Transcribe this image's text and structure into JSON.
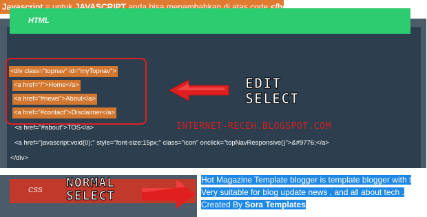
{
  "top_note": {
    "prefix": "Javascript",
    "middle": " = untuk ",
    "lang": "JAVASCRIPT",
    "suffix": " anda bisa menambahkan di atas code ",
    "tag": "</body>"
  },
  "html_panel": {
    "title": "HTML",
    "code_lines": [
      "<div class=\"topnav\" id=\"myTopnav\">",
      "<a href=\"/\">Home</a>",
      "<a href=\"#news\">About</a>",
      "<a href=\"#contact\">Disclaimer</a>",
      "<a href=\"#about\">TOS</a>",
      "<a href=\"javascript:void(0);\" style=\"font-size:15px;\" class=\"icon\" onclick=\"topNavResponsive()\">&#9776;</a>",
      "</div>"
    ]
  },
  "captions": {
    "edit_line1": "EDIT",
    "edit_line2": "SELECT",
    "normal_line1": "NORMAL",
    "normal_line2": "SELECT"
  },
  "watermark": "INTERNET-RECEH.BLOGSPOT.COM",
  "css_panel": {
    "title": "CSS"
  },
  "selected_text": {
    "line1": "Hot Magazine Template blogger is template blogger with t",
    "line2": " Very suitable for blog update news , and all about tech .",
    "line3_prefix": "Created By ",
    "line3_brand": "Sora Templates"
  },
  "colors": {
    "orange_note": "#e07b31",
    "dark_panel": "#2d3e4e",
    "html_bar": "#2ecc71",
    "css_bar": "#c0392b",
    "selection_orange": "#d2772f",
    "selection_blue": "#1e88e5",
    "callout_red": "#e02020"
  },
  "icons": {
    "left_arrow": "red-arrow-left-icon",
    "right_arrow": "red-arrow-right-icon"
  }
}
